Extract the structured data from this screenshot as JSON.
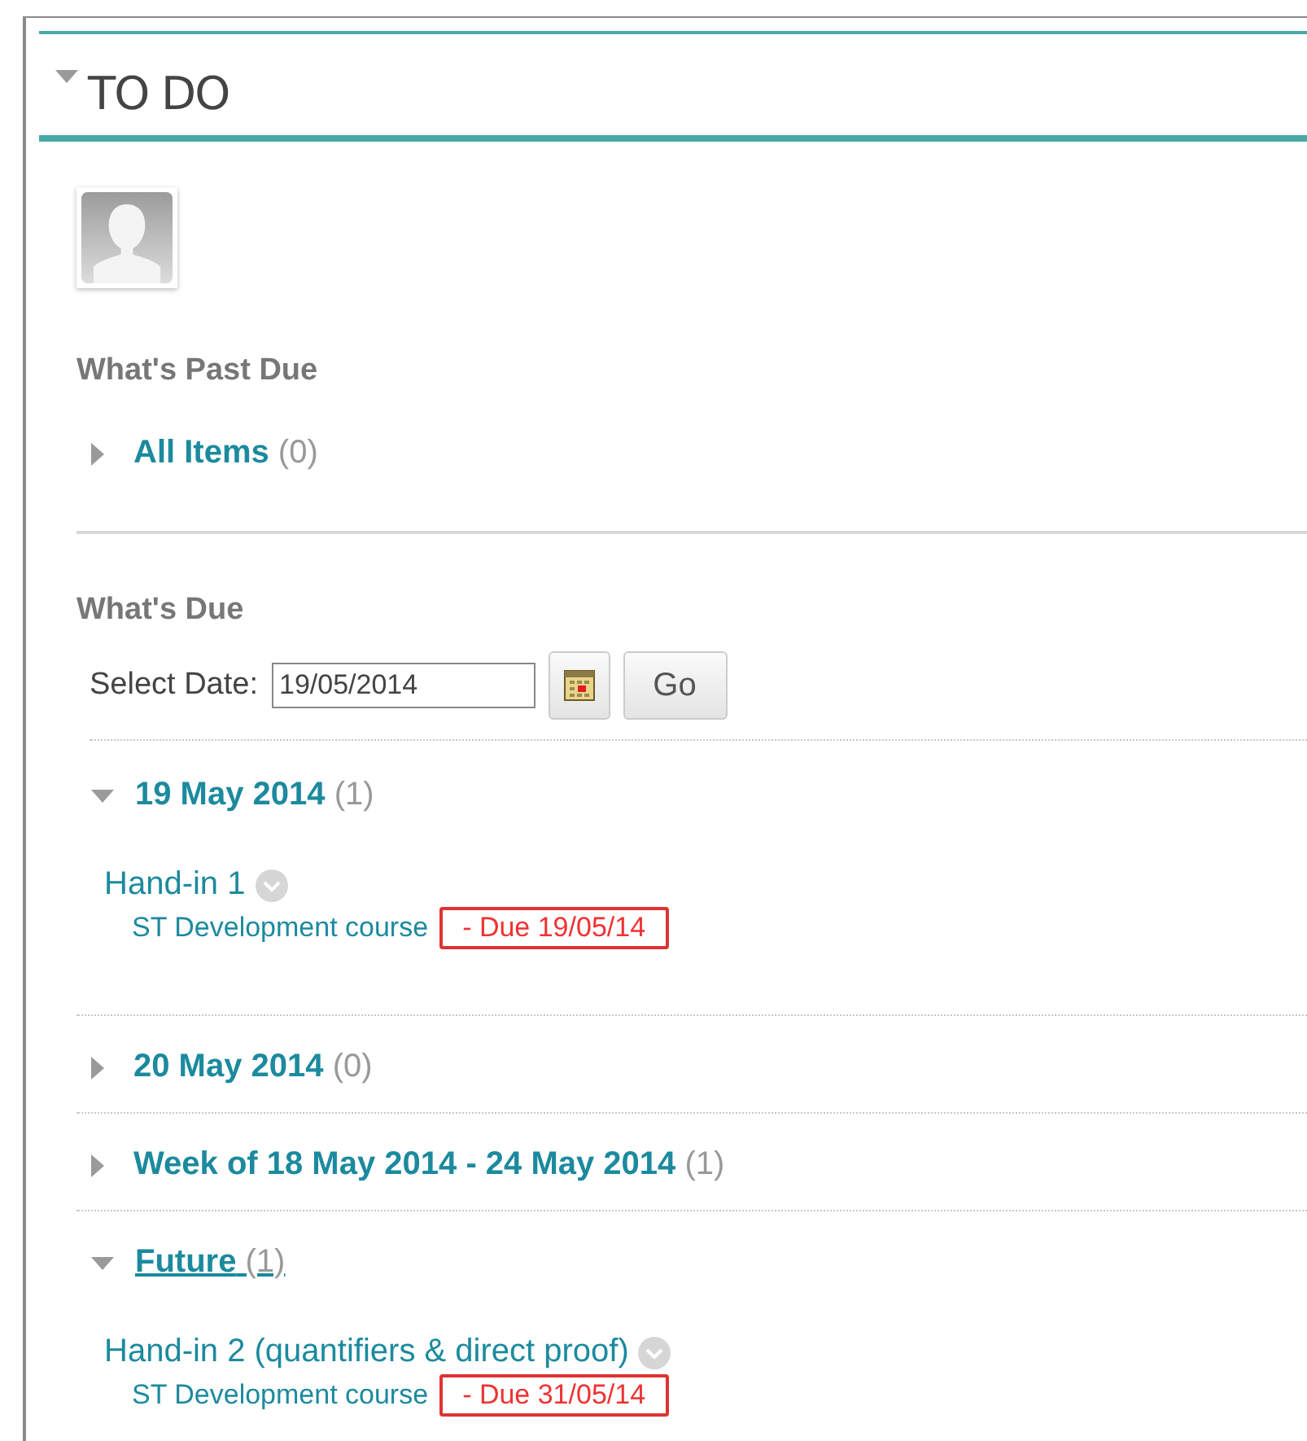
{
  "module": {
    "title": "TO DO",
    "expanded": true
  },
  "past_due": {
    "heading": "What's Past Due",
    "groups": [
      {
        "title": "All Items",
        "count": "(0)",
        "expanded": false,
        "underlined": false
      }
    ]
  },
  "due": {
    "heading": "What's Due",
    "date_label": "Select Date:",
    "date_value": "19/05/2014",
    "go_button": "Go",
    "groups": [
      {
        "title": "19 May 2014",
        "count": "(1)",
        "expanded": true,
        "underlined": false,
        "items": [
          {
            "title": "Hand-in 1",
            "course": "ST Development course",
            "due": "- Due 19/05/14"
          }
        ]
      },
      {
        "title": "20 May 2014",
        "count": "(0)",
        "expanded": false,
        "underlined": false
      },
      {
        "title": "Week of 18 May 2014 - 24 May 2014",
        "count": "(1)",
        "expanded": false,
        "underlined": false
      },
      {
        "title": "Future",
        "count": "(1)",
        "expanded": true,
        "underlined": true,
        "items": [
          {
            "title": "Hand-in 2 (quantifiers & direct proof)",
            "course": "ST Development course",
            "due": "- Due 31/05/14"
          }
        ]
      }
    ]
  }
}
